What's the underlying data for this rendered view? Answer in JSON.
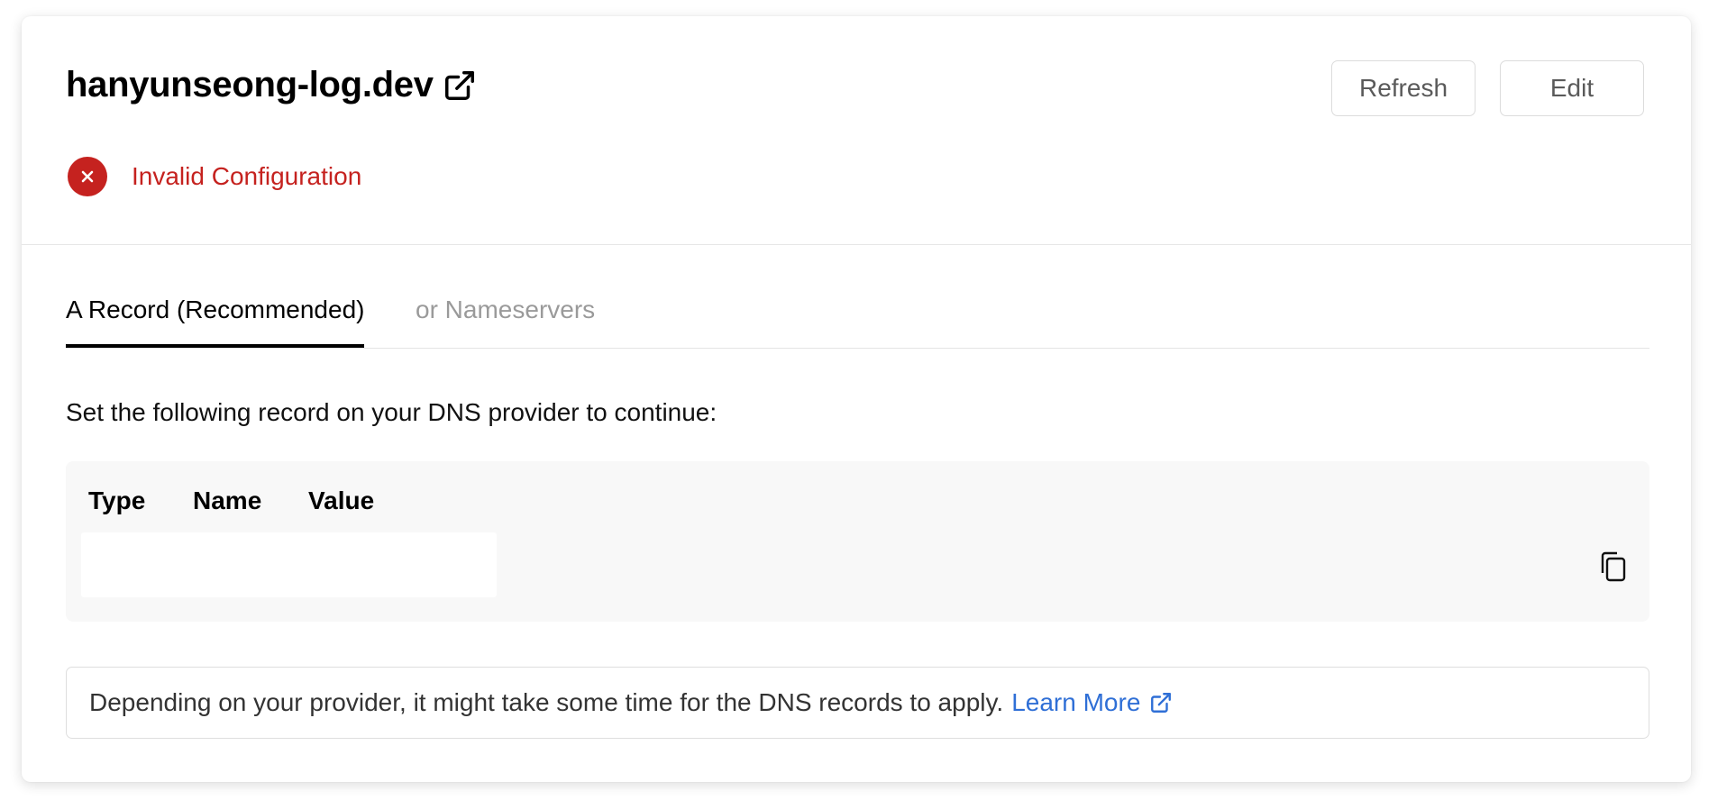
{
  "domain": {
    "title": "hanyunseong-log.dev",
    "external_icon": "external-link-icon"
  },
  "actions": {
    "refresh_label": "Refresh",
    "edit_label": "Edit"
  },
  "status": {
    "icon": "error-x-icon",
    "text": "Invalid Configuration",
    "color": "#c5221f"
  },
  "tabs": [
    {
      "label": "A Record (Recommended)",
      "active": true
    },
    {
      "label": "or Nameservers",
      "active": false
    }
  ],
  "instruction": "Set the following record on your DNS provider to continue:",
  "record_table": {
    "headers": [
      "Type",
      "Name",
      "Value"
    ],
    "copy_icon": "copy-icon"
  },
  "note": {
    "text": "Depending on your provider, it might take some time for the DNS records to apply.",
    "link_label": "Learn More",
    "link_color": "#2f6fd6",
    "link_icon": "external-link-icon"
  }
}
